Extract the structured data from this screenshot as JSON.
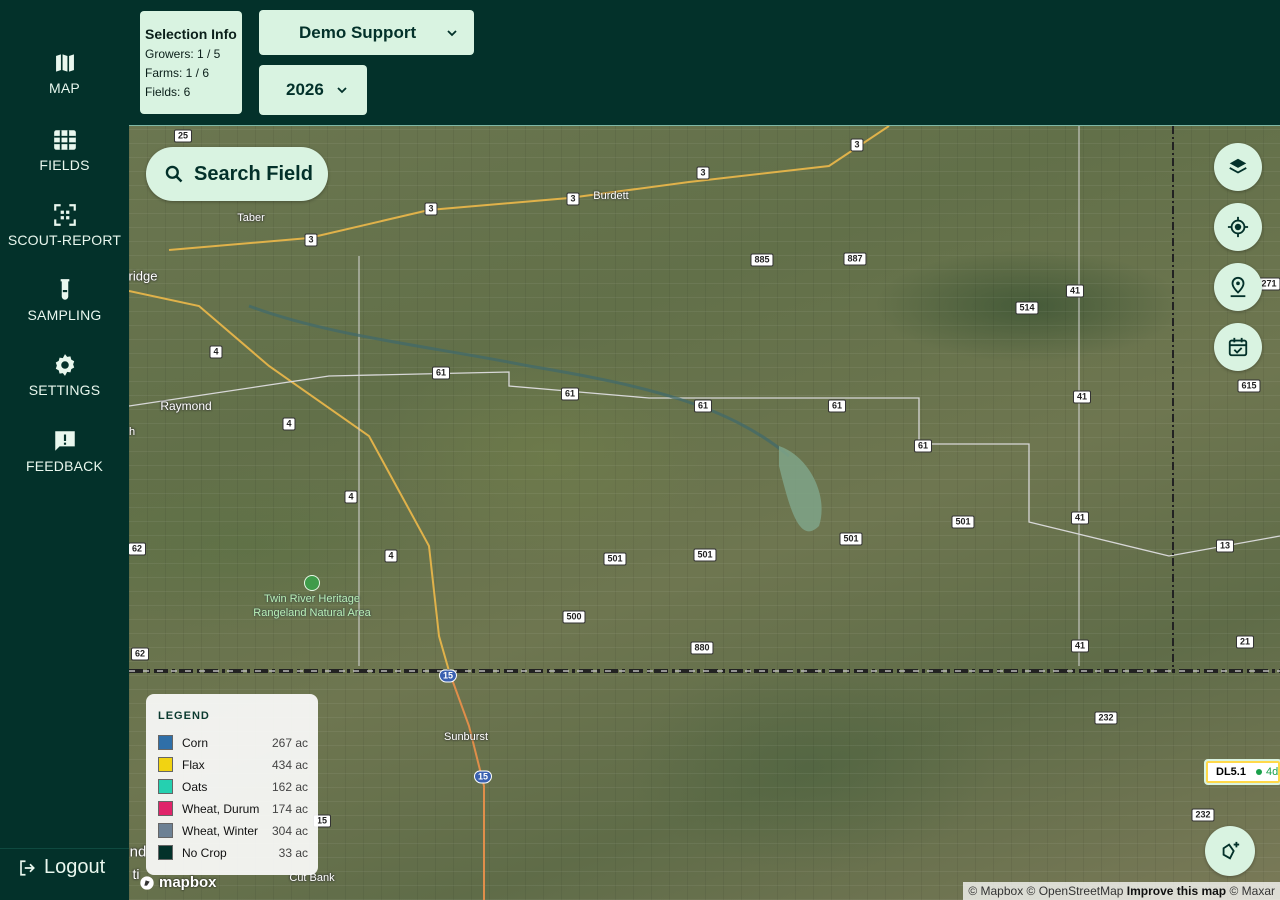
{
  "sidebar": {
    "items": [
      {
        "label": "MAP",
        "icon": "map-icon"
      },
      {
        "label": "FIELDS",
        "icon": "grid-icon"
      },
      {
        "label": "SCOUT-REPORT",
        "icon": "scan-icon"
      },
      {
        "label": "SAMPLING",
        "icon": "test-tube-icon"
      },
      {
        "label": "SETTINGS",
        "icon": "gear-icon"
      },
      {
        "label": "FEEDBACK",
        "icon": "feedback-icon"
      }
    ],
    "logout_label": "Logout"
  },
  "selection_info": {
    "title": "Selection Info",
    "growers": "Growers: 1 / 5",
    "farms": "Farms: 1 / 6",
    "fields": "Fields: 6"
  },
  "grower_select": {
    "value": "Demo Support"
  },
  "year_select": {
    "value": "2026"
  },
  "search": {
    "label": "Search Field"
  },
  "map_controls": [
    {
      "name": "layers-button",
      "icon": "layers-icon"
    },
    {
      "name": "locate-button",
      "icon": "crosshair-icon"
    },
    {
      "name": "pin-button",
      "icon": "map-pin-icon"
    },
    {
      "name": "calendar-button",
      "icon": "calendar-check-icon"
    },
    {
      "name": "add-field-button",
      "icon": "add-polygon-icon"
    }
  ],
  "legend": {
    "title": "LEGEND",
    "items": [
      {
        "name": "Corn",
        "acres": "267 ac",
        "color": "#2f6fa8"
      },
      {
        "name": "Flax",
        "acres": "434 ac",
        "color": "#f1d312"
      },
      {
        "name": "Oats",
        "acres": "162 ac",
        "color": "#25d0b0"
      },
      {
        "name": "Wheat, Durum",
        "acres": "174 ac",
        "color": "#e0246a"
      },
      {
        "name": "Wheat, Winter",
        "acres": "304 ac",
        "color": "#6d8194"
      },
      {
        "name": "No Crop",
        "acres": "33 ac",
        "color": "#03312a"
      }
    ]
  },
  "map_labels": {
    "towns": [
      "Taber",
      "Burdett",
      "ridge",
      "Raymond",
      "h",
      "Sunburst",
      "Cut Bank",
      "nd",
      "ti"
    ],
    "park": [
      "Twin River Heritage",
      "Rangeland Natural Area"
    ],
    "shields": [
      "25",
      "3",
      "3",
      "3",
      "3",
      "3",
      "885",
      "887",
      "514",
      "41",
      "271",
      "4",
      "61",
      "61",
      "61",
      "61",
      "61",
      "41",
      "615",
      "4",
      "4",
      "4",
      "501",
      "501",
      "501",
      "501",
      "41",
      "13",
      "62",
      "500",
      "880",
      "41",
      "21",
      "62",
      "15",
      "15",
      "232",
      "232",
      "15"
    ]
  },
  "field_badge": {
    "label": "DL5.1",
    "age": "4d"
  },
  "attribution": {
    "mapbox": "© Mapbox",
    "osm": "© OpenStreetMap",
    "improve": "Improve this map",
    "maxar": "© Maxar"
  },
  "mapbox_logo": "mapbox",
  "colors": {
    "brand_dark": "#03312a",
    "brand_light": "#d9f3e1"
  }
}
